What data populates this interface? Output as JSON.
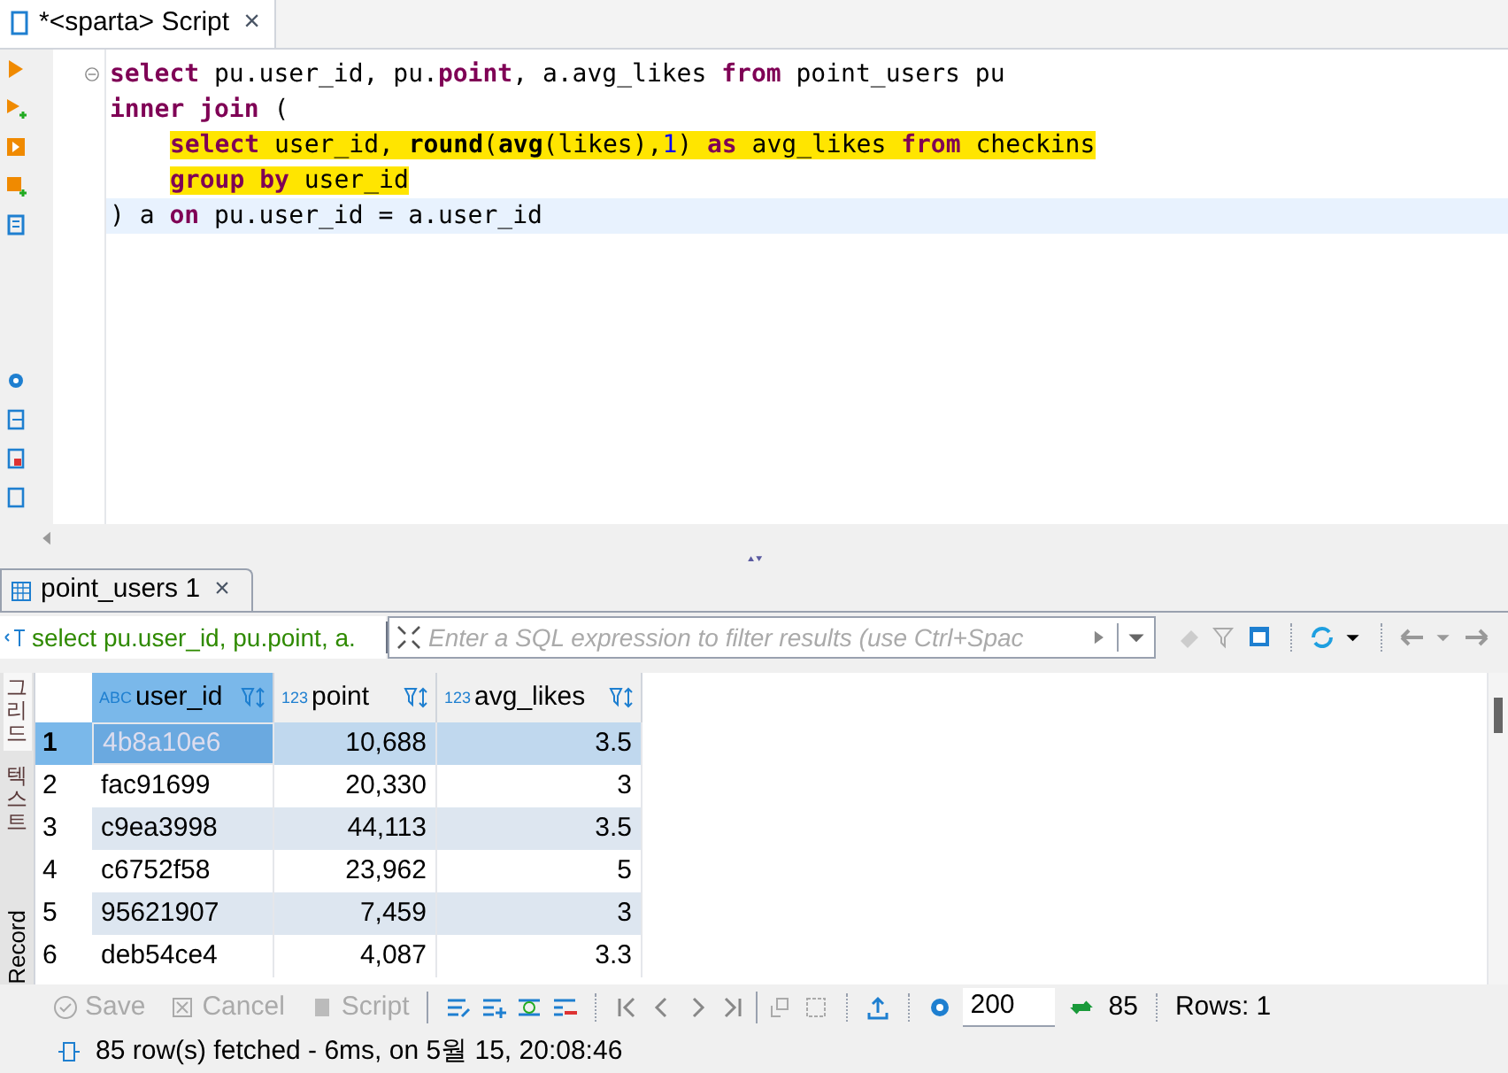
{
  "editor_tab": {
    "title": "*<sparta> Script",
    "close": "×",
    "selected": true
  },
  "code_lines": [
    {
      "highlighted": false,
      "current": false,
      "segments": [
        {
          "kind": "keyword",
          "text": "select"
        },
        {
          "kind": "plain",
          "text": " pu.user_id, pu."
        },
        {
          "kind": "keyword",
          "text": "point"
        },
        {
          "kind": "plain",
          "text": ", a.avg_likes "
        },
        {
          "kind": "keyword",
          "text": "from"
        },
        {
          "kind": "plain",
          "text": " point_users pu"
        }
      ]
    },
    {
      "highlighted": false,
      "current": false,
      "segments": [
        {
          "kind": "keyword",
          "text": "inner join"
        },
        {
          "kind": "plain",
          "text": " ("
        }
      ],
      "children": [
        {
          "highlighted": true,
          "current": false,
          "segments": [
            {
              "kind": "keyword",
              "text": "select"
            },
            {
              "kind": "plain",
              "text": " user_id, "
            },
            {
              "kind": "func",
              "text": "round"
            },
            {
              "kind": "plain",
              "text": "("
            },
            {
              "kind": "func",
              "text": "avg"
            },
            {
              "kind": "plain",
              "text": "(likes),"
            },
            {
              "kind": "number",
              "text": "1"
            },
            {
              "kind": "plain",
              "text": ") "
            },
            {
              "kind": "keyword",
              "text": "as"
            },
            {
              "kind": "plain",
              "text": " avg_likes "
            },
            {
              "kind": "keyword",
              "text": "from"
            },
            {
              "kind": "plain",
              "text": " checkins"
            }
          ]
        },
        {
          "highlighted": true,
          "current": false,
          "segments": [
            {
              "kind": "keyword",
              "text": "group by"
            },
            {
              "kind": "plain",
              "text": " user_id"
            }
          ]
        }
      ]
    },
    {
      "highlighted": false,
      "current": true,
      "segments": [
        {
          "kind": "plain",
          "text": ") a "
        },
        {
          "kind": "keyword",
          "text": "on"
        },
        {
          "kind": "plain",
          "text": " pu.user_id = a.user_id"
        }
      ]
    }
  ],
  "results_tab": {
    "title": "point_users 1",
    "close": "×",
    "selected": true
  },
  "filter_bar": {
    "query": "select pu.user_id, pu.point, a.",
    "placeholder": "Enter a SQL expression to filter results (use Ctrl+Spac"
  },
  "side_tabs": [
    {
      "label": "그리드",
      "kind": "korean",
      "selected": true
    },
    {
      "label": "텍스트",
      "kind": "korean",
      "selected": false
    },
    {
      "label": "Record",
      "kind": "latin",
      "selected": false
    }
  ],
  "table": {
    "columns": [
      {
        "name": "user_id",
        "type": "ABC",
        "kind": "text",
        "selected": true
      },
      {
        "name": "point",
        "type": "123",
        "kind": "number",
        "selected": false
      },
      {
        "name": "avg_likes",
        "type": "123",
        "kind": "number",
        "selected": false
      }
    ],
    "rows": [
      {
        "number": "1",
        "selected": true,
        "cells": [
          "4b8a10e6",
          "10,688",
          "3.5"
        ]
      },
      {
        "number": "2",
        "selected": false,
        "cells": [
          "fac91699",
          "20,330",
          "3"
        ]
      },
      {
        "number": "3",
        "selected": false,
        "cells": [
          "c9ea3998",
          "44,113",
          "3.5"
        ]
      },
      {
        "number": "4",
        "selected": false,
        "cells": [
          "c6752f58",
          "23,962",
          "5"
        ]
      },
      {
        "number": "5",
        "selected": false,
        "cells": [
          "95621907",
          "7,459",
          "3"
        ]
      },
      {
        "number": "6",
        "selected": false,
        "cells": [
          "deb54ce4",
          "4,087",
          "3.3"
        ]
      }
    ]
  },
  "toolbar": {
    "save": "Save",
    "cancel": "Cancel",
    "script": "Script",
    "fetch_size": "200",
    "fetched_count": "85",
    "rows": "Rows: 1"
  },
  "status": "85 row(s) fetched - 6ms, on 5월 15, 20:08:46"
}
